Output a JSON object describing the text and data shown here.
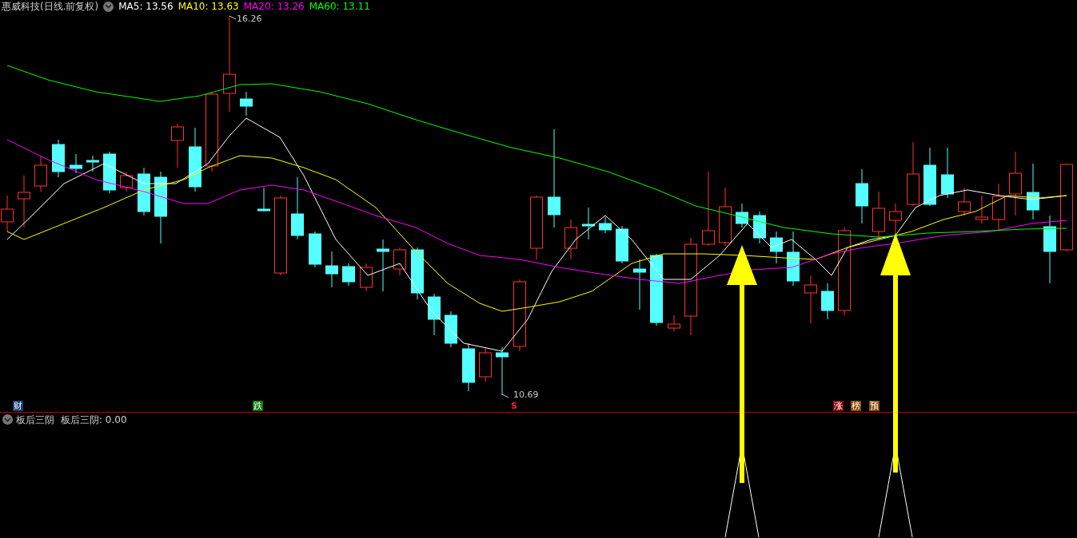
{
  "header": {
    "title": "惠威科技(日线.前复权)",
    "ma": [
      {
        "label": "MA5:",
        "value": "13.56",
        "color": "#ffffff"
      },
      {
        "label": "MA10:",
        "value": "13.63",
        "color": "#ffff00"
      },
      {
        "label": "MA20:",
        "value": "13.26",
        "color": "#ff00ff"
      },
      {
        "label": "MA60:",
        "value": "13.11",
        "color": "#00ff00"
      }
    ]
  },
  "price_labels": [
    {
      "text": "16.26"
    },
    {
      "text": "10.69"
    }
  ],
  "markers": [
    {
      "text": "财",
      "kind": "tag",
      "color": "#1c3f7a"
    },
    {
      "text": "跌",
      "kind": "tag",
      "color": "#0e7a12"
    },
    {
      "text": "S",
      "kind": "plain",
      "color": "#ff2020"
    },
    {
      "text": "涨",
      "kind": "tag",
      "color": "#8b0a0a"
    },
    {
      "text": "榜",
      "kind": "tag",
      "color": "#8a4a0c"
    },
    {
      "text": "预",
      "kind": "tag",
      "color": "#8a4a0c"
    }
  ],
  "indicator": {
    "name": "板后三阴",
    "reading": "板后三阴: 0.00"
  }
}
